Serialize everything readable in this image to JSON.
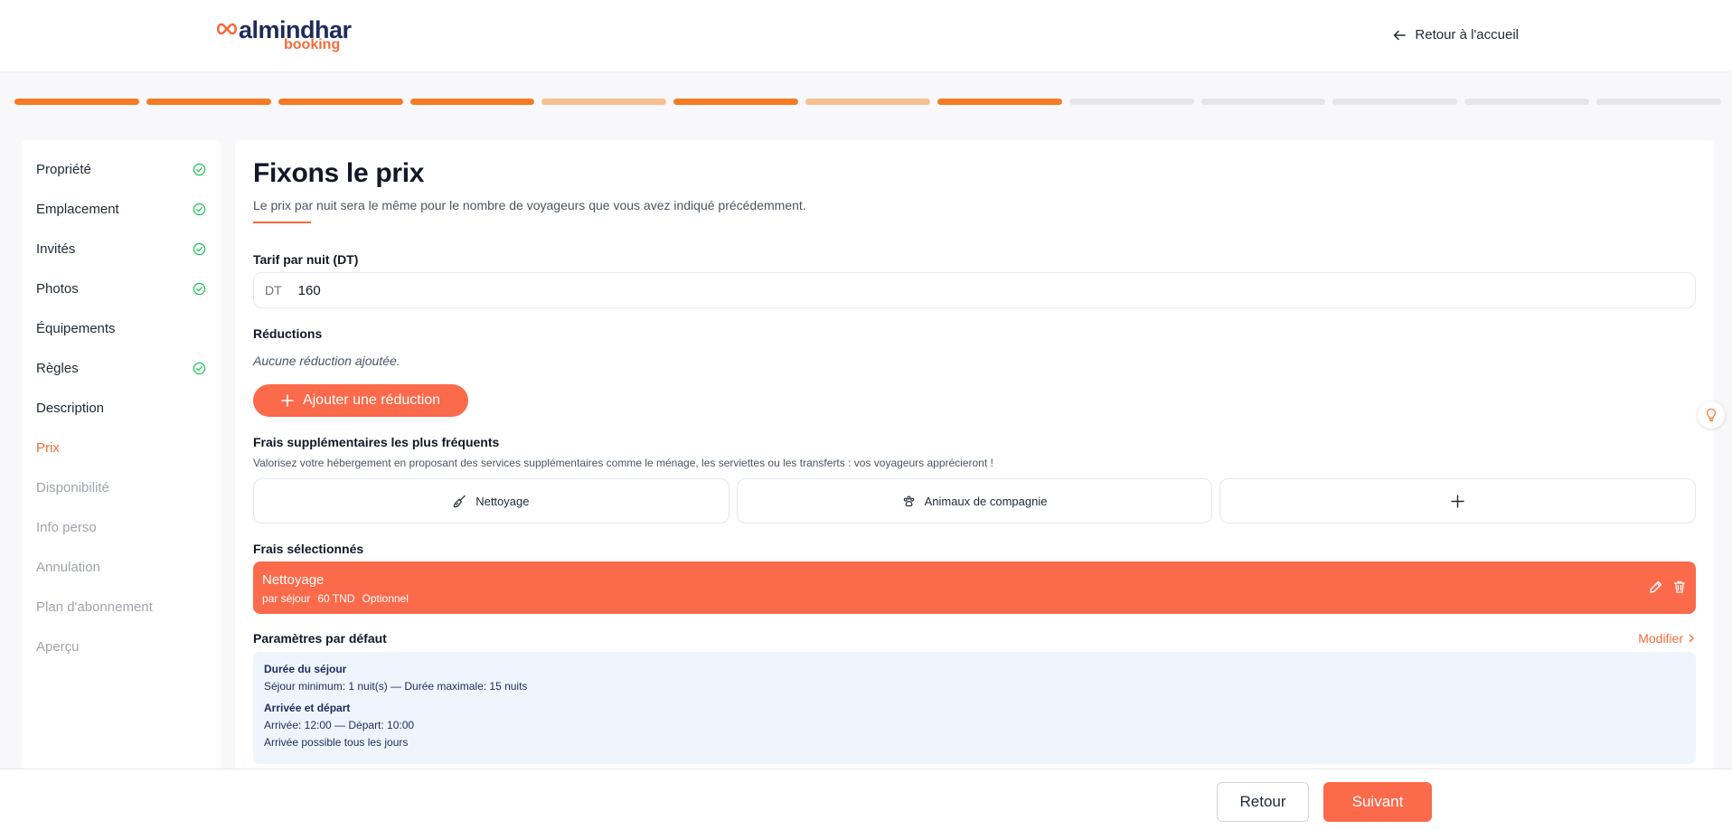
{
  "header": {
    "brand": "almindhar",
    "brand_sub": "booking",
    "back_home": "Retour à l'accueil"
  },
  "progress": {
    "steps": [
      "done",
      "done",
      "done",
      "done",
      "partial",
      "done",
      "partial",
      "done",
      "todo",
      "todo",
      "todo",
      "todo",
      "todo"
    ]
  },
  "sidebar": {
    "items": [
      {
        "label": "Propriété",
        "state": "done"
      },
      {
        "label": "Emplacement",
        "state": "done"
      },
      {
        "label": "Invités",
        "state": "done"
      },
      {
        "label": "Photos",
        "state": "done"
      },
      {
        "label": "Équipements",
        "state": "normal"
      },
      {
        "label": "Règles",
        "state": "done"
      },
      {
        "label": "Description",
        "state": "normal"
      },
      {
        "label": "Prix",
        "state": "active"
      },
      {
        "label": "Disponibilité",
        "state": "pending"
      },
      {
        "label": "Info perso",
        "state": "pending"
      },
      {
        "label": "Annulation",
        "state": "pending"
      },
      {
        "label": "Plan d'abonnement",
        "state": "pending"
      },
      {
        "label": "Aperçu",
        "state": "pending"
      }
    ]
  },
  "main": {
    "title": "Fixons le prix",
    "subtitle": "Le prix par nuit sera le même pour le nombre de voyageurs que vous avez indiqué précédemment.",
    "price": {
      "label": "Tarif par nuit (DT)",
      "prefix": "DT",
      "value": "160"
    },
    "reductions": {
      "label": "Réductions",
      "empty": "Aucune réduction ajoutée.",
      "add_button": "Ajouter une réduction"
    },
    "fees": {
      "label": "Frais supplémentaires les plus fréquents",
      "help": "Valorisez votre hébergement en proposant des services supplémentaires comme le ménage, les serviettes ou les transferts : vos voyageurs apprécieront !",
      "cards": [
        {
          "label": "Nettoyage",
          "icon": "broom-icon"
        },
        {
          "label": "Animaux de compagnie",
          "icon": "paw-icon"
        },
        {
          "label": "",
          "icon": "plus-icon"
        }
      ]
    },
    "selected": {
      "label": "Frais sélectionnés",
      "item": {
        "name": "Nettoyage",
        "frequency": "par séjour",
        "amount": "60 TND",
        "type": "Optionnel"
      }
    },
    "defaults": {
      "label": "Paramètres par défaut",
      "modify": "Modifier",
      "stay_title": "Durée du séjour",
      "stay_line": "Séjour minimum: 1 nuit(s) — Durée maximale: 15 nuits",
      "checkin_title": "Arrivée et départ",
      "checkin_line": "Arrivée: 12:00 — Départ: 10:00",
      "checkin_days": "Arrivée possible tous les jours"
    }
  },
  "footer": {
    "back": "Retour",
    "next": "Suivant"
  },
  "colors": {
    "accent": "#fb6a4a",
    "progress_done": "#f47a24",
    "progress_partial": "#f8c090",
    "check": "#22c55e",
    "brand_navy": "#1f2b5a"
  }
}
